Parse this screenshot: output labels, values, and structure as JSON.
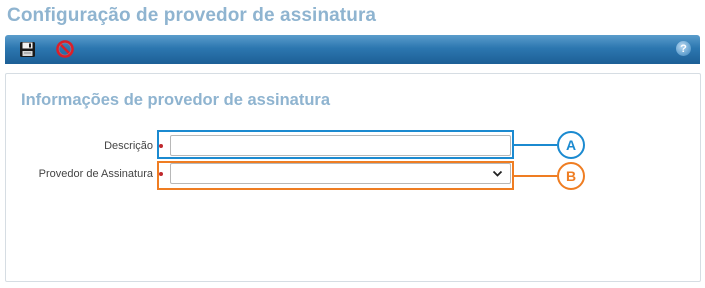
{
  "page": {
    "title": "Configuração de provedor de assinatura"
  },
  "toolbar": {
    "save_icon": "floppy-disk-icon",
    "cancel_icon": "no-entry-icon",
    "help_label": "?",
    "colors": {
      "gradient_top": "#5a9ccb",
      "gradient_bottom": "#1d5f96"
    }
  },
  "form": {
    "section_title": "Informações de provedor de assinatura",
    "fields": [
      {
        "label": "Descrição",
        "required": true,
        "value": "",
        "type": "text"
      },
      {
        "label": "Provedor de Assinatura",
        "required": true,
        "value": "",
        "type": "select"
      }
    ]
  },
  "annotations": {
    "a": {
      "label": "A",
      "color": "#1b8ad0"
    },
    "b": {
      "label": "B",
      "color": "#ef7d22"
    }
  },
  "colors": {
    "title": "#8fb4d0",
    "required_marker": "#c0282d"
  }
}
